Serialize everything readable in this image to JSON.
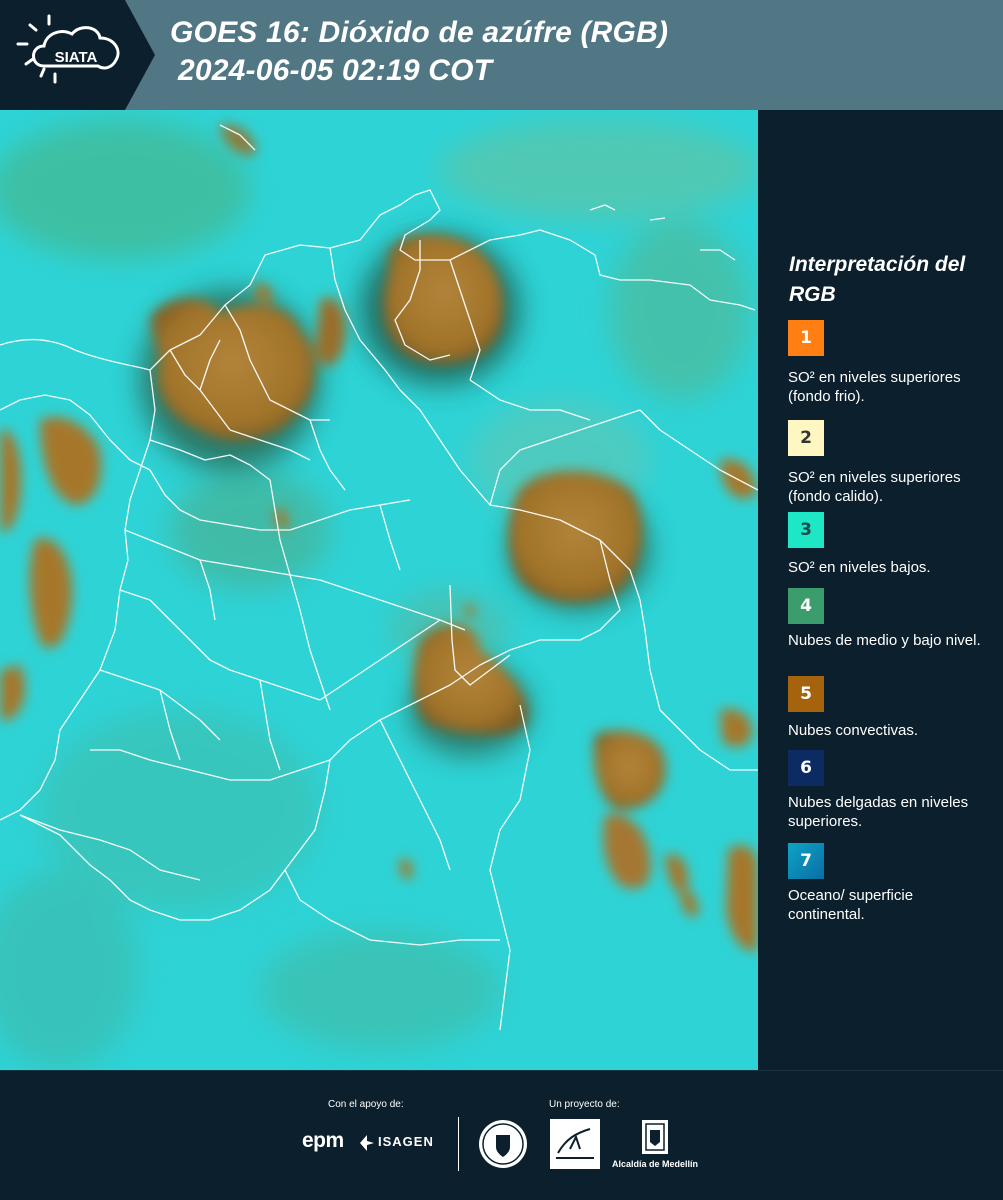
{
  "header": {
    "logo_text": "SIATA",
    "title_line1": "GOES 16: Dióxido de azúfre (RGB)",
    "title_line2": "2024-06-05 02:19 COT"
  },
  "legend": {
    "title": "Interpretación del RGB",
    "items": [
      {
        "number": "1",
        "color": "#ff7f13",
        "text": "SO² en niveles superiores (fondo frio)."
      },
      {
        "number": "2",
        "color": "#fef7c2",
        "text": "SO² en niveles superiores (fondo calido)."
      },
      {
        "number": "3",
        "color": "#1de7c4",
        "text": "SO² en niveles bajos."
      },
      {
        "number": "4",
        "color": "#3c9d6c",
        "text": "Nubes de medio y bajo nivel."
      },
      {
        "number": "5",
        "color": "#a5630d",
        "text": "Nubes convectivas."
      },
      {
        "number": "6",
        "color": "#0d2b63",
        "text": "Nubes delgadas en niveles superiores."
      },
      {
        "number": "7",
        "color": "#0e89b8",
        "text": "Oceano/ superficie continental."
      }
    ]
  },
  "footer": {
    "support_label": "Con el apoyo de:",
    "project_label": "Un proyecto de:",
    "sponsor_1": "epm",
    "sponsor_2": "ISAGEN",
    "partner_3": "Alcaldía de Medellín"
  },
  "map": {
    "background_color": "#2fcfd3",
    "cloud_color": "#a9792c",
    "low_cloud_color": "#5aa56e",
    "border_color": "#ffffff"
  }
}
